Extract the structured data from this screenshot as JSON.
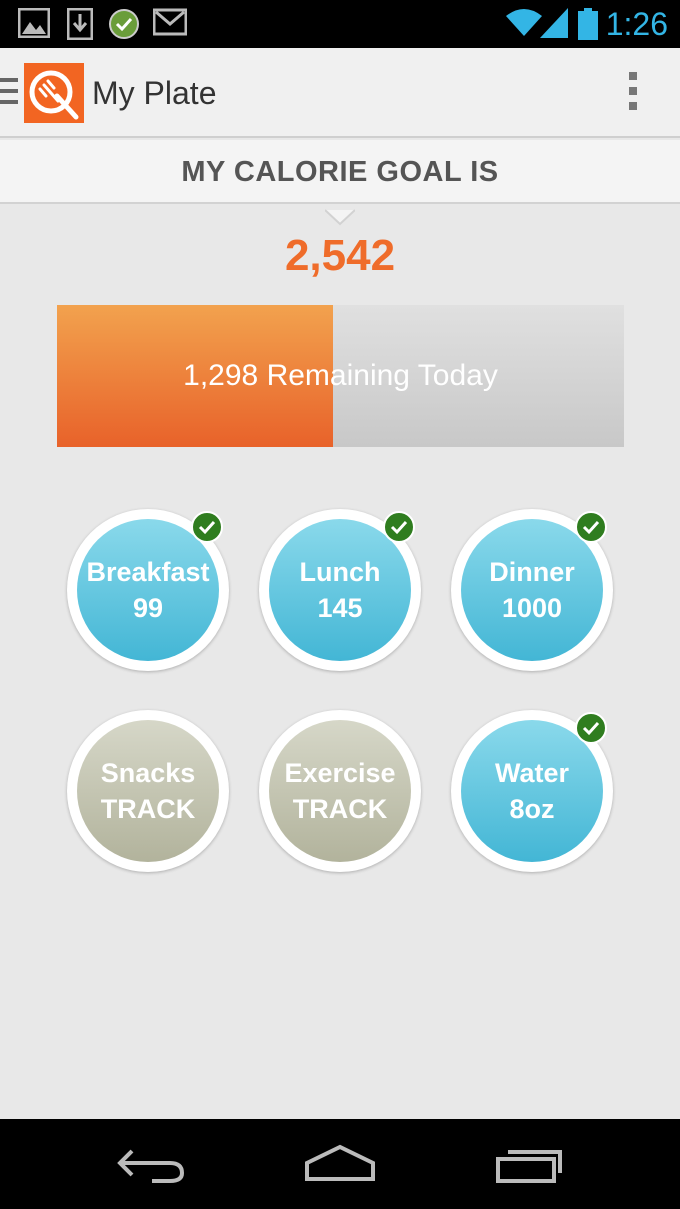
{
  "status_bar": {
    "time": "1:26",
    "colors": {
      "background": "#000000",
      "accent": "#33b5e5"
    },
    "icons": [
      "image-icon",
      "download-icon",
      "check-circle-icon",
      "gmail-icon",
      "wifi-icon",
      "signal-icon",
      "battery-icon"
    ]
  },
  "action_bar": {
    "title": "My Plate",
    "logo_icon": "plate-fork-knife-icon",
    "menu_icon": "hamburger-icon",
    "overflow_icon": "overflow-menu-icon",
    "colors": {
      "brand": "#f26522"
    }
  },
  "goal": {
    "header": "MY CALORIE GOAL IS",
    "value": "2,542",
    "colors": {
      "value": "#ef6c2a"
    }
  },
  "progress": {
    "label": "1,298 Remaining Today",
    "consumed_fraction": 0.486
  },
  "meals": [
    {
      "name": "Breakfast",
      "value": "99",
      "style": "blue",
      "checked": true
    },
    {
      "name": "Lunch",
      "value": "145",
      "style": "blue",
      "checked": true
    },
    {
      "name": "Dinner",
      "value": "1000",
      "style": "blue",
      "checked": true
    },
    {
      "name": "Snacks",
      "value": "TRACK",
      "style": "gray",
      "checked": false
    },
    {
      "name": "Exercise",
      "value": "TRACK",
      "style": "gray",
      "checked": false
    },
    {
      "name": "Water",
      "value": "8oz",
      "style": "blue",
      "checked": true
    }
  ],
  "nav_bar": {
    "buttons": [
      "back-icon",
      "home-icon",
      "recent-apps-icon"
    ]
  }
}
